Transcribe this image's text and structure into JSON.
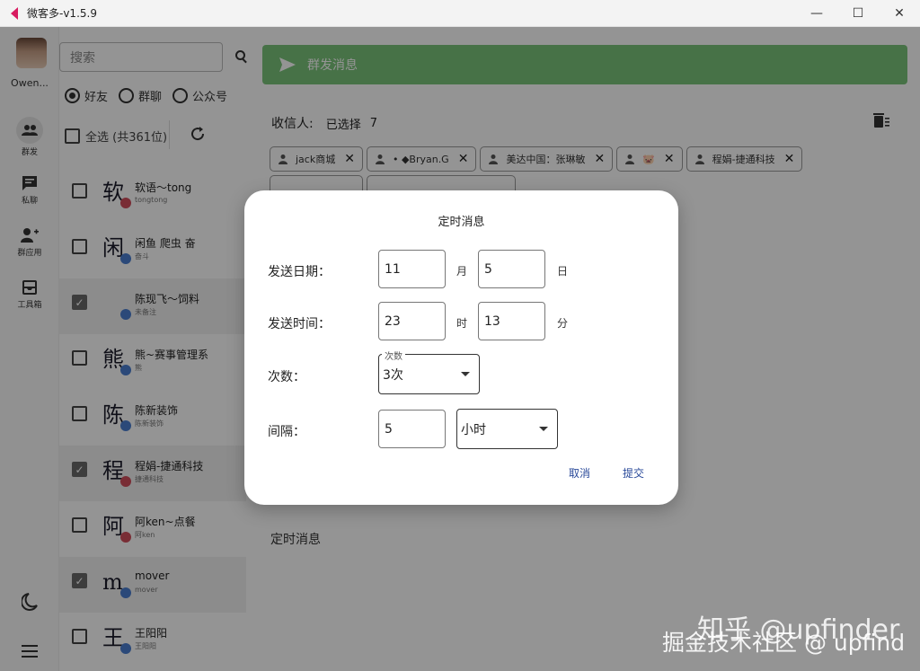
{
  "window": {
    "title": "微客多-v1.5.9",
    "minimize": "—",
    "maximize": "☐",
    "close": "✕"
  },
  "nav": {
    "user_name": "Owen...",
    "items": [
      {
        "label": "群发"
      },
      {
        "label": "私聊"
      },
      {
        "label": "群应用"
      },
      {
        "label": "工具箱"
      }
    ]
  },
  "contacts": {
    "search_placeholder": "搜索",
    "radios": [
      {
        "label": "好友",
        "checked": true
      },
      {
        "label": "群聊",
        "checked": false
      },
      {
        "label": "公众号",
        "checked": false
      }
    ],
    "select_all_label": "全选 (共361位)",
    "rows": [
      {
        "big": "软",
        "name": "软语～tong",
        "sub": "tongtong",
        "checked": false
      },
      {
        "big": "闲",
        "name": "闲鱼 爬虫 奋",
        "sub": "奋斗",
        "checked": false
      },
      {
        "big": "",
        "name": "陈现飞～饲料",
        "sub": "未备注",
        "checked": true
      },
      {
        "big": "熊",
        "name": "熊~赛事管理系",
        "sub": "熊",
        "checked": false
      },
      {
        "big": "陈",
        "name": "陈新装饰",
        "sub": "陈新装饰",
        "checked": false
      },
      {
        "big": "程",
        "name": "程娟-捷通科技",
        "sub": "捷通科技",
        "checked": true
      },
      {
        "big": "阿",
        "name": "阿ken~点餐",
        "sub": "阿ken",
        "checked": false
      },
      {
        "big": "m",
        "name": "mover",
        "sub": "mover",
        "checked": true
      },
      {
        "big": "王",
        "name": "王阳阳",
        "sub": "王阳阳",
        "checked": false
      }
    ]
  },
  "main": {
    "send_label": "群发消息",
    "recipients_label": "收信人:",
    "selected_label": "已选择",
    "selected_count": "7",
    "chips": [
      {
        "label": "jack商城"
      },
      {
        "label": "• ◆Bryan.G"
      },
      {
        "label": "美达中国：张琳敏"
      },
      {
        "label": "🐷"
      },
      {
        "label": "程娟-捷通科技"
      },
      {
        "label": ""
      },
      {
        "label": ""
      }
    ],
    "timed_label": "定时消息"
  },
  "dialog": {
    "title": "定时消息",
    "date_label": "发送日期：",
    "month_value": "11",
    "month_unit": "月",
    "day_value": "5",
    "day_unit": "日",
    "time_label": "发送时间：",
    "hour_value": "23",
    "hour_unit": "时",
    "minute_value": "13",
    "minute_unit": "分",
    "count_label": "次数：",
    "count_legend": "次数",
    "count_value": "3次",
    "interval_label": "间隔：",
    "interval_value": "5",
    "interval_unit_value": "小时",
    "cancel_label": "取消",
    "submit_label": "提交"
  },
  "watermark": {
    "line1": "知乎 @upfinder",
    "line2": "掘金技术社区 @ upfind"
  }
}
